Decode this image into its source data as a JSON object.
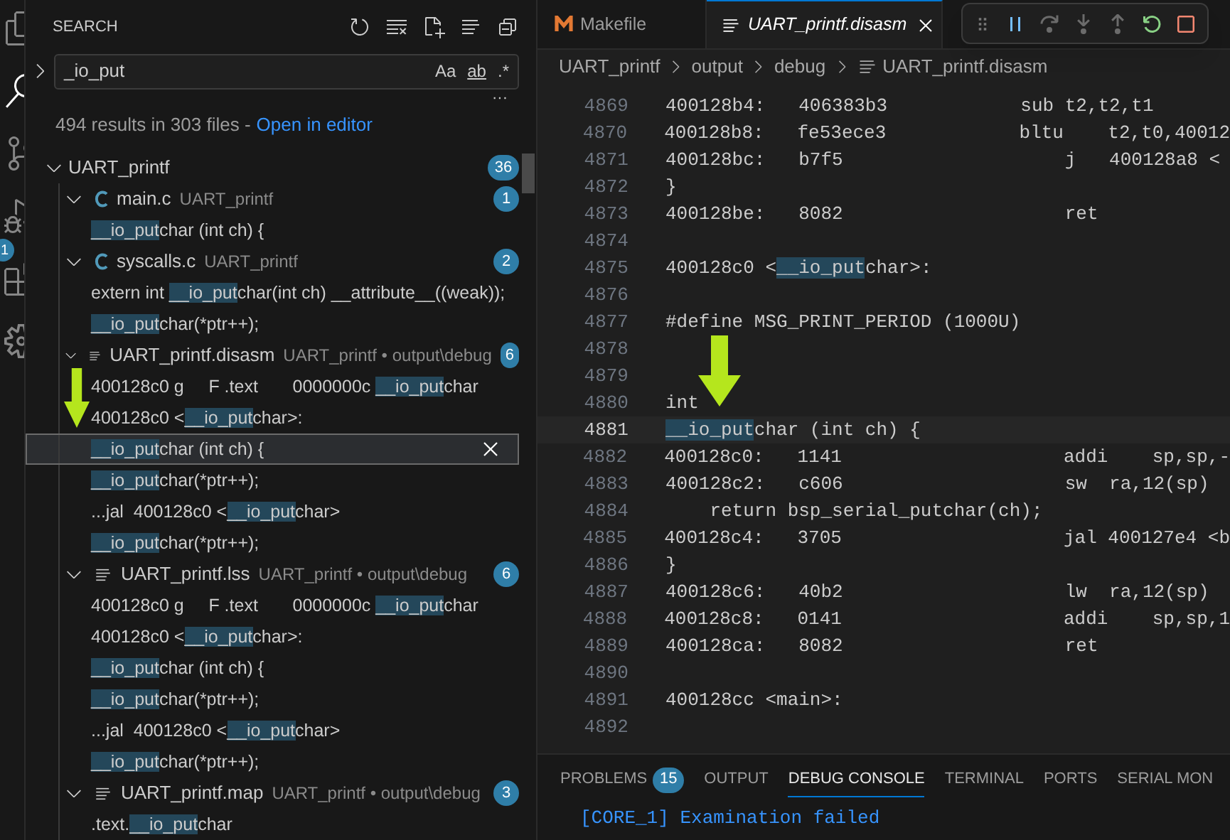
{
  "activity_bar": {
    "badge": "1"
  },
  "sidebar": {
    "title": "SEARCH",
    "search": {
      "value": "_io_put",
      "options": [
        "Aa",
        "ab",
        ".*"
      ]
    },
    "more": "···",
    "summary": "494 results in 303 files -",
    "open_link": "Open in editor",
    "tree": {
      "label": "UART_printf",
      "count": "36",
      "expanded": true,
      "children": [
        {
          "kind": "c",
          "name": "main.c",
          "path": "UART_printf",
          "count": "1",
          "expanded": true,
          "matches": [
            {
              "match": "__io_put",
              "after": "char (int ch) {",
              "selected": false
            }
          ]
        },
        {
          "kind": "c",
          "name": "syscalls.c",
          "path": "UART_printf",
          "count": "2",
          "expanded": true,
          "matches": [
            {
              "before": "extern int ",
              "match": "__io_put",
              "after": "char(int ch) __attribute__((weak));",
              "selected": false
            },
            {
              "match": "__io_put",
              "after": "char(*ptr++);",
              "selected": false
            }
          ]
        },
        {
          "kind": "text",
          "name": "UART_printf.disasm",
          "path": "UART_printf • output\\debug",
          "count": "6",
          "expanded": true,
          "matches": [
            {
              "before": "400128c0 g     F .text       0000000c ",
              "match": "__io_put",
              "after": "char",
              "selected": false
            },
            {
              "before": "400128c0 <",
              "match": "__io_put",
              "after": "char>:",
              "selected": false
            },
            {
              "match": "__io_put",
              "after": "char (int ch) {",
              "selected": true
            },
            {
              "match": "__io_put",
              "after": "char(*ptr++);",
              "selected": false
            },
            {
              "before": "...jal  400128c0 <",
              "match": "__io_put",
              "after": "char>",
              "selected": false
            },
            {
              "match": "__io_put",
              "after": "char(*ptr++);",
              "selected": false
            }
          ]
        },
        {
          "kind": "text",
          "name": "UART_printf.lss",
          "path": "UART_printf • output\\debug",
          "count": "6",
          "expanded": true,
          "matches": [
            {
              "before": "400128c0 g     F .text       0000000c ",
              "match": "__io_put",
              "after": "char",
              "selected": false
            },
            {
              "before": "400128c0 <",
              "match": "__io_put",
              "after": "char>:",
              "selected": false
            },
            {
              "match": "__io_put",
              "after": "char (int ch) {",
              "selected": false
            },
            {
              "match": "__io_put",
              "after": "char(*ptr++);",
              "selected": false
            },
            {
              "before": "...jal  400128c0 <",
              "match": "__io_put",
              "after": "char>",
              "selected": false
            },
            {
              "match": "__io_put",
              "after": "char(*ptr++);",
              "selected": false
            }
          ]
        },
        {
          "kind": "text",
          "name": "UART_printf.map",
          "path": "UART_printf • output\\debug",
          "count": "3",
          "expanded": true,
          "matches": [
            {
              "before": ".text.",
              "match": "__io_put",
              "after": "char",
              "selected": false
            }
          ]
        }
      ]
    }
  },
  "editor": {
    "tabs": [
      {
        "label": "Makefile",
        "kind": "makefile",
        "selected": false
      },
      {
        "label": "UART_printf.disasm",
        "kind": "text",
        "selected": true
      }
    ],
    "debug_toolbar": [
      {
        "kind": "pause",
        "disabled": false
      },
      {
        "kind": "step-over",
        "disabled": true
      },
      {
        "kind": "step-into",
        "disabled": true
      },
      {
        "kind": "step-out",
        "disabled": true
      },
      {
        "kind": "restart",
        "disabled": false
      },
      {
        "kind": "stop",
        "disabled": false
      }
    ],
    "breadcrumbs": [
      "UART_printf",
      "output",
      "debug",
      "UART_printf.disasm"
    ],
    "lines": [
      {
        "number": "4869",
        "text": "400128b4:   406383b3            sub t2,t2,t1",
        "current": false
      },
      {
        "number": "4870",
        "text": "400128b8:   fe53ece3            bltu    t2,t0,40012",
        "current": false
      },
      {
        "number": "4871",
        "text": "400128bc:   b7f5                    j   400128a8 <",
        "current": false
      },
      {
        "number": "4872",
        "text": "}",
        "current": false
      },
      {
        "number": "4873",
        "text": "400128be:   8082                    ret",
        "current": false
      },
      {
        "number": "4874",
        "current": false
      },
      {
        "number": "4875",
        "before": "400128c0 <",
        "match": "__io_put",
        "after": "char>:",
        "current": false
      },
      {
        "number": "4876",
        "current": false
      },
      {
        "number": "4877",
        "text": "#define MSG_PRINT_PERIOD (1000U)",
        "current": false
      },
      {
        "number": "4878",
        "current": false
      },
      {
        "number": "4879",
        "current": false
      },
      {
        "number": "4880",
        "text": "int",
        "current": false
      },
      {
        "number": "4881",
        "match": "__io_put",
        "after": "char (int ch) {",
        "current": true
      },
      {
        "number": "4882",
        "text": "400128c0:   1141                    addi    sp,sp,-",
        "current": false
      },
      {
        "number": "4883",
        "text": "400128c2:   c606                    sw  ra,12(sp)",
        "current": false
      },
      {
        "number": "4884",
        "text": "    return bsp_serial_putchar(ch);",
        "current": false
      },
      {
        "number": "4885",
        "text": "400128c4:   3705                    jal 400127e4 <b",
        "current": false
      },
      {
        "number": "4886",
        "text": "}",
        "current": false
      },
      {
        "number": "4887",
        "text": "400128c6:   40b2                    lw  ra,12(sp)",
        "current": false
      },
      {
        "number": "4888",
        "text": "400128c8:   0141                    addi    sp,sp,1",
        "current": false
      },
      {
        "number": "4889",
        "text": "400128ca:   8082                    ret",
        "current": false
      },
      {
        "number": "4890",
        "current": false
      },
      {
        "number": "4891",
        "text": "400128cc <main>:",
        "current": false
      },
      {
        "number": "4892",
        "current": false
      }
    ]
  },
  "panel": {
    "tabs": [
      {
        "label": "PROBLEMS",
        "badge": "15",
        "selected": false
      },
      {
        "label": "OUTPUT",
        "selected": false
      },
      {
        "label": "DEBUG CONSOLE",
        "selected": true
      },
      {
        "label": "TERMINAL",
        "selected": false
      },
      {
        "label": "PORTS",
        "selected": false
      },
      {
        "label": "SERIAL MON",
        "selected": false
      }
    ],
    "console": [
      "[CORE_1] Examination failed"
    ]
  }
}
